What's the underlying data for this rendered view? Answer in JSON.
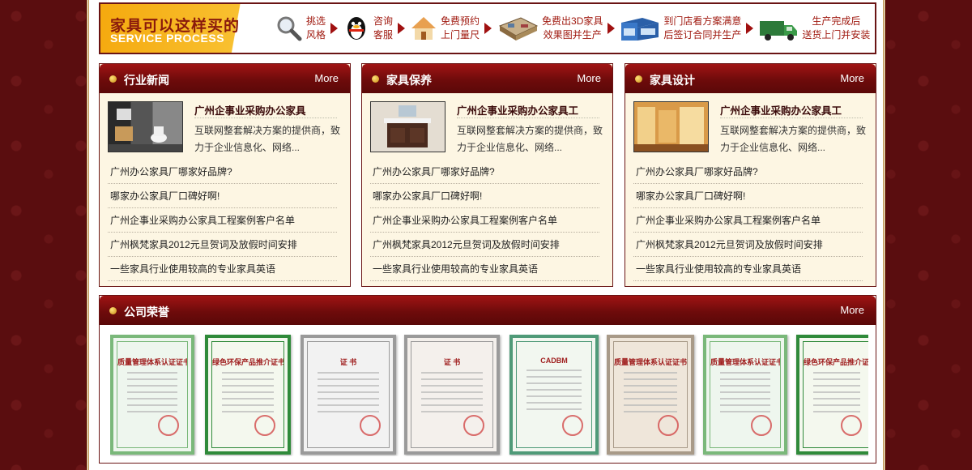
{
  "banner": {
    "title_cn": "家具可以这样买的",
    "title_en": "SERVICE PROCESS",
    "steps": [
      {
        "icon": "magnifier-icon",
        "line1": "挑选",
        "line2": "风格"
      },
      {
        "icon": "qq-penguin-icon",
        "line1": "咨询",
        "line2": "客服"
      },
      {
        "icon": "house-icon",
        "line1": "免费预约",
        "line2": "上门量尺"
      },
      {
        "icon": "3d-room-icon",
        "line1": "免费出3D家具",
        "line2": "效果图并生产"
      },
      {
        "icon": "storefront-icon",
        "line1": "到门店看方案满意",
        "line2": "后签订合同并生产"
      },
      {
        "icon": "delivery-truck-icon",
        "line1": "生产完成后",
        "line2": "送货上门并安装"
      }
    ]
  },
  "panels": [
    {
      "title": "行业新闻",
      "more": "More",
      "feature_title": "广州企事业采购办公家具",
      "feature_desc": "互联网整套解决方案的提供商，致力于企业信息化、网络...",
      "thumb_icon": "bathroom-photo-icon",
      "items": [
        "广州办公家具厂哪家好品牌?",
        "哪家办公家具厂口碑好啊!",
        "广州企事业采购办公家具工程案例客户名单",
        "广州枫梵家具2012元旦贺词及放假时间安排",
        "一些家具行业使用较高的专业家具英语"
      ]
    },
    {
      "title": "家具保养",
      "more": "More",
      "feature_title": "广州企事业采购办公家具工",
      "feature_desc": "互联网整套解决方案的提供商，致力于企业信息化、网络...",
      "thumb_icon": "vanity-cabinet-photo-icon",
      "items": [
        "广州办公家具厂哪家好品牌?",
        "哪家办公家具厂口碑好啊!",
        "广州企事业采购办公家具工程案例客户名单",
        "广州枫梵家具2012元旦贺词及放假时间安排",
        "一些家具行业使用较高的专业家具英语"
      ]
    },
    {
      "title": "家具设计",
      "more": "More",
      "feature_title": "广州企事业采购办公家具工",
      "feature_desc": "互联网整套解决方案的提供商，致力于企业信息化、网络...",
      "thumb_icon": "furniture-showroom-photo-icon",
      "items": [
        "广州办公家具厂哪家好品牌?",
        "哪家办公家具厂口碑好啊!",
        "广州企事业采购办公家具工程案例客户名单",
        "广州枫梵家具2012元旦贺词及放假时间安排",
        "一些家具行业使用较高的专业家具英语"
      ]
    }
  ],
  "honor": {
    "title": "公司荣誉",
    "more": "More",
    "certs": [
      {
        "icon": "certificate-icon",
        "heading": "质量管理体系认证证书",
        "frame": "#7ab87a",
        "bg": "#eef6ee"
      },
      {
        "icon": "certificate-icon",
        "heading": "绿色环保产品推介证书",
        "frame": "#2f8a3a",
        "bg": "#f4f8ee"
      },
      {
        "icon": "certificate-icon",
        "heading": "证 书",
        "frame": "#9a9a9a",
        "bg": "#f2f2f2"
      },
      {
        "icon": "certificate-icon",
        "heading": "证 书",
        "frame": "#9a9a9a",
        "bg": "#f4f0ec"
      },
      {
        "icon": "certificate-icon",
        "heading": "CADBM",
        "frame": "#4f9a78",
        "bg": "#f2f7f0"
      },
      {
        "icon": "certificate-icon",
        "heading": "质量管理体系认证证书",
        "frame": "#a89a88",
        "bg": "#efe6da"
      },
      {
        "icon": "certificate-icon",
        "heading": "质量管理体系认证证书",
        "frame": "#7ab87a",
        "bg": "#eef6ee"
      },
      {
        "icon": "certificate-icon",
        "heading": "绿色环保产品推介证书",
        "frame": "#2f8a3a",
        "bg": "#f4f8ee"
      }
    ]
  }
}
